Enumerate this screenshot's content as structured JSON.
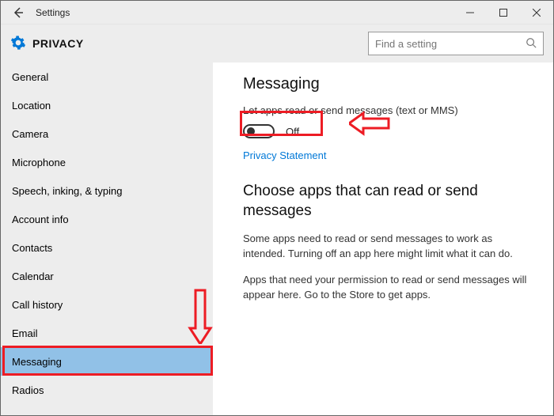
{
  "window": {
    "title": "Settings"
  },
  "header": {
    "page_title": "PRIVACY",
    "search_placeholder": "Find a setting"
  },
  "sidebar": {
    "items": [
      {
        "label": "General"
      },
      {
        "label": "Location"
      },
      {
        "label": "Camera"
      },
      {
        "label": "Microphone"
      },
      {
        "label": "Speech, inking, & typing"
      },
      {
        "label": "Account info"
      },
      {
        "label": "Contacts"
      },
      {
        "label": "Calendar"
      },
      {
        "label": "Call history"
      },
      {
        "label": "Email"
      },
      {
        "label": "Messaging"
      },
      {
        "label": "Radios"
      }
    ],
    "selected": "Messaging"
  },
  "content": {
    "heading": "Messaging",
    "toggle_desc": "Let apps read or send messages (text or MMS)",
    "toggle_state": "Off",
    "privacy_link": "Privacy Statement",
    "subheading": "Choose apps that can read or send messages",
    "para1": "Some apps need to read or send messages to work as intended. Turning off an app here might limit what it can do.",
    "para2": "Apps that need your permission to read or send messages will appear here. Go to the Store to get apps."
  },
  "accent_color": "#0078d7"
}
